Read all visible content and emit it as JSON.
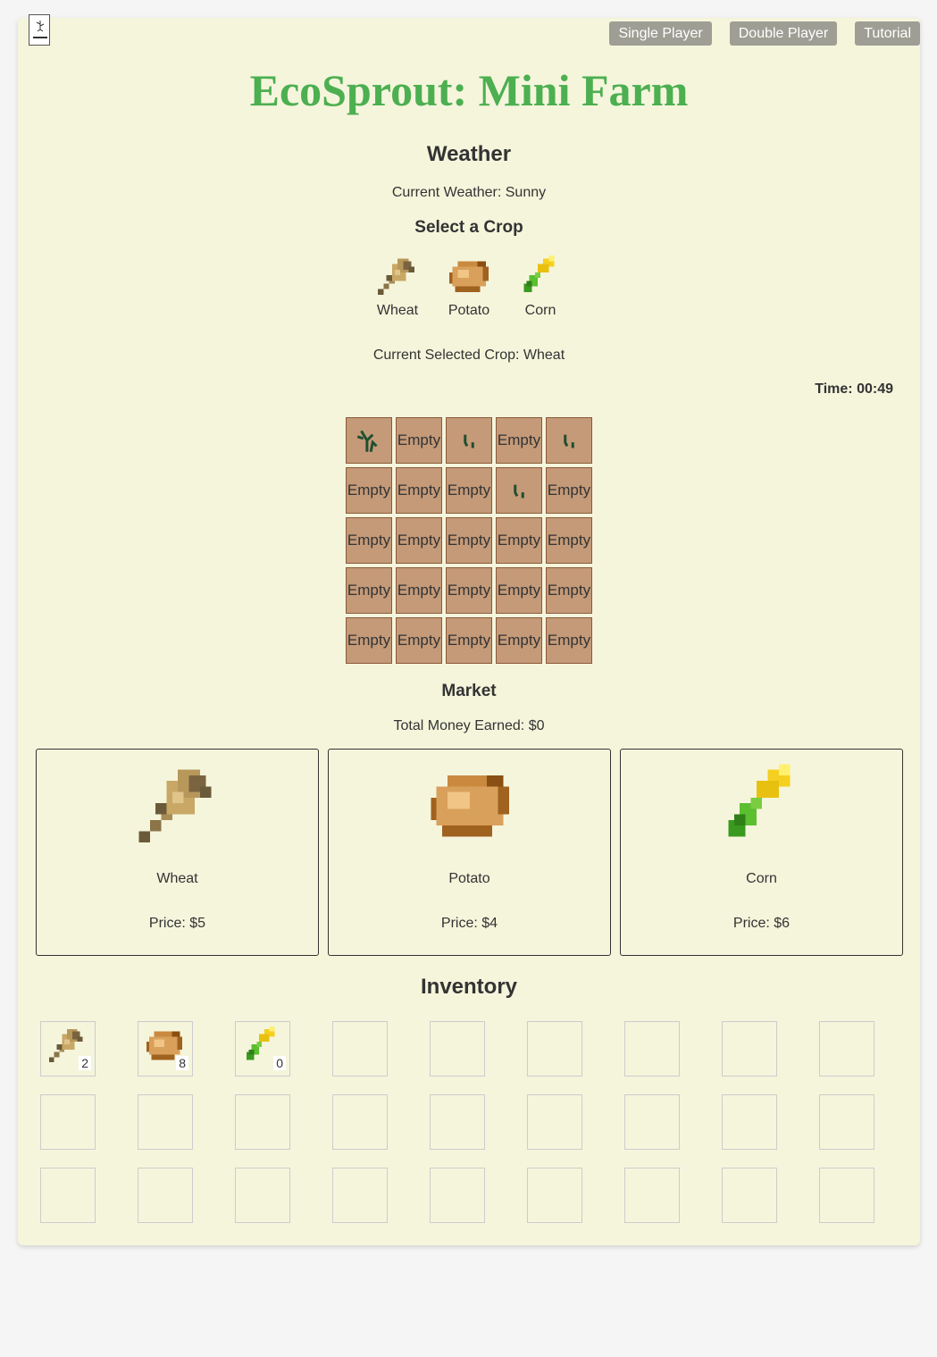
{
  "nav": {
    "single_player": "Single Player",
    "double_player": "Double Player",
    "tutorial": "Tutorial"
  },
  "title": "EcoSprout: Mini Farm",
  "weather": {
    "heading": "Weather",
    "current": "Current Weather: Sunny"
  },
  "crop_select": {
    "heading": "Select a Crop",
    "crops": [
      {
        "label": "Wheat",
        "icon": "wheat-icon"
      },
      {
        "label": "Potato",
        "icon": "potato-icon"
      },
      {
        "label": "Corn",
        "icon": "corn-icon"
      }
    ],
    "selected": "Current Selected Crop: Wheat"
  },
  "timer": "Time: 00:49",
  "field": {
    "plots": [
      "sprout-large",
      "Empty",
      "sprout-small",
      "Empty",
      "sprout-small",
      "Empty",
      "Empty",
      "Empty",
      "sprout-small",
      "Empty",
      "Empty",
      "Empty",
      "Empty",
      "Empty",
      "Empty",
      "Empty",
      "Empty",
      "Empty",
      "Empty",
      "Empty",
      "Empty",
      "Empty",
      "Empty",
      "Empty",
      "Empty"
    ]
  },
  "market": {
    "heading": "Market",
    "total": "Total Money Earned: $0",
    "items": [
      {
        "name": "Wheat",
        "price": "Price: $5",
        "icon": "wheat-icon"
      },
      {
        "name": "Potato",
        "price": "Price: $4",
        "icon": "potato-icon"
      },
      {
        "name": "Corn",
        "price": "Price: $6",
        "icon": "corn-icon"
      }
    ]
  },
  "inventory": {
    "heading": "Inventory",
    "items": [
      {
        "icon": "wheat-icon",
        "count": "2"
      },
      {
        "icon": "potato-icon",
        "count": "8"
      },
      {
        "icon": "corn-icon",
        "count": "0"
      }
    ],
    "total_slots": 27
  }
}
